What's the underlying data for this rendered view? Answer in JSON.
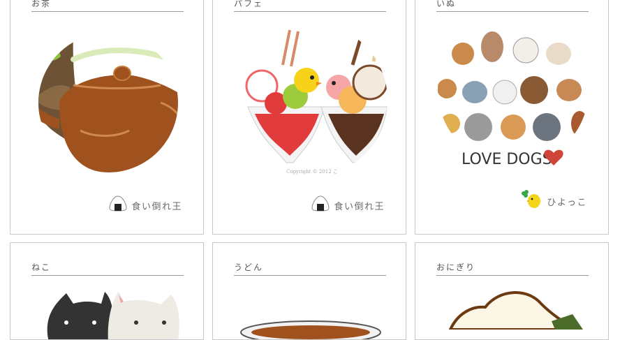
{
  "cards": [
    {
      "title": "お茶",
      "author": "食い倒れ王",
      "author_icon": "onigiri-icon"
    },
    {
      "title": "パフェ",
      "author": "食い倒れ王",
      "author_icon": "onigiri-icon",
      "watermark": "Copyright © 2012 こ"
    },
    {
      "title": "いぬ",
      "author": "ひよっこ",
      "author_icon": "chick-clover-icon",
      "art_text": "LOVE DOGS"
    },
    {
      "title": "ねこ"
    },
    {
      "title": "うどん"
    },
    {
      "title": "おにぎり"
    }
  ],
  "colors": {
    "border": "#c8c8c8",
    "title_text": "#555555",
    "teapot": "#a0521e",
    "matcha": "#8cc63f"
  }
}
